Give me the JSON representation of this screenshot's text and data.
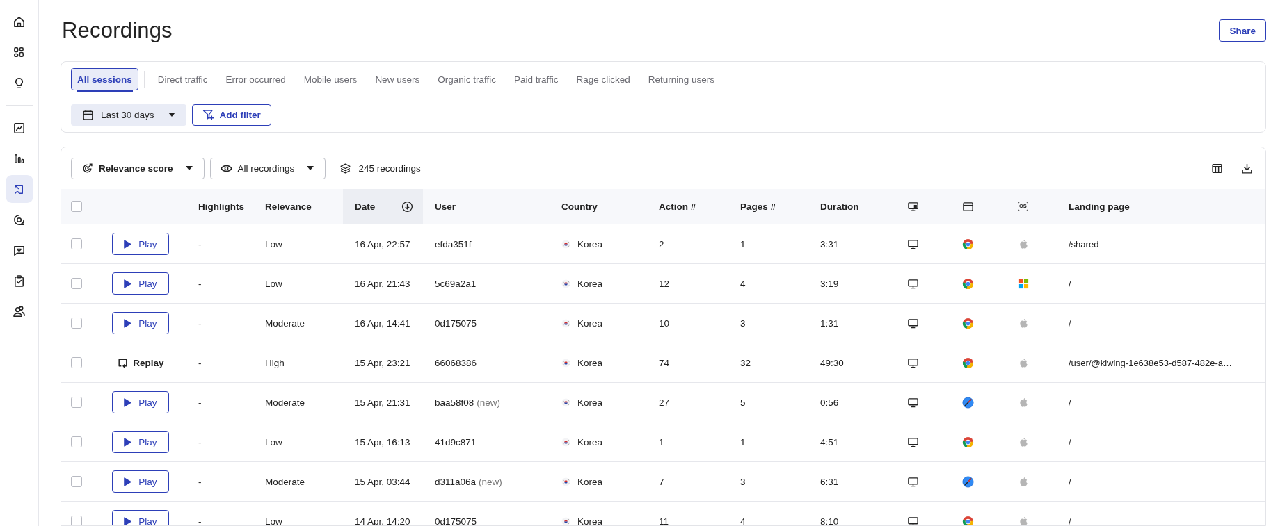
{
  "sidebar": {
    "top": [
      {
        "kind": "home",
        "selected": false
      },
      {
        "kind": "grid",
        "selected": false
      },
      {
        "kind": "bulb",
        "selected": false
      }
    ],
    "bottom": [
      {
        "kind": "chart",
        "selected": false
      },
      {
        "kind": "bars",
        "selected": false
      },
      {
        "kind": "recordings",
        "selected": true
      },
      {
        "kind": "mention",
        "selected": false
      },
      {
        "kind": "feedback",
        "selected": false
      },
      {
        "kind": "clipboard",
        "selected": false
      },
      {
        "kind": "users",
        "selected": false
      }
    ]
  },
  "title": "Recordings",
  "share_button": "Share",
  "segments": [
    {
      "label": "All sessions",
      "selected": true
    },
    {
      "label": "Direct traffic",
      "selected": false
    },
    {
      "label": "Error occurred",
      "selected": false
    },
    {
      "label": "Mobile users",
      "selected": false
    },
    {
      "label": "New users",
      "selected": false
    },
    {
      "label": "Organic traffic",
      "selected": false
    },
    {
      "label": "Paid traffic",
      "selected": false
    },
    {
      "label": "Rage clicked",
      "selected": false
    },
    {
      "label": "Returning users",
      "selected": false
    }
  ],
  "date_range": "Last 30 days",
  "add_filter": "Add filter",
  "sort_select": "Relevance score",
  "recordings_select": "All recordings",
  "recordings_count": "245 recordings",
  "table": {
    "select_all": {
      "checked": false
    },
    "columns": [
      {
        "kind": "text",
        "label": "Highlights"
      },
      {
        "kind": "text",
        "label": "Relevance"
      },
      {
        "kind": "sort",
        "label": "Date"
      },
      {
        "kind": "text",
        "label": "User"
      },
      {
        "kind": "text",
        "label": "Country"
      },
      {
        "kind": "text",
        "label": "Action #"
      },
      {
        "kind": "text",
        "label": "Pages #"
      },
      {
        "kind": "text",
        "label": "Duration"
      },
      {
        "kind": "device"
      },
      {
        "kind": "browser"
      },
      {
        "kind": "os",
        "label": "OS"
      },
      {
        "kind": "text",
        "label": "Landing page"
      }
    ],
    "rows": [
      {
        "checked": false,
        "kind": "play",
        "button": "Play",
        "highlights": "-",
        "relevance": "Low",
        "date": "16 Apr, 22:57",
        "user": "efda351f",
        "country": "Korea",
        "actions": "2",
        "pages": "1",
        "duration": "3:31",
        "browser": {
          "kind": "chrome"
        },
        "os": {
          "kind": "apple"
        },
        "landing": "/shared"
      },
      {
        "checked": false,
        "kind": "play",
        "button": "Play",
        "highlights": "-",
        "relevance": "Low",
        "date": "16 Apr, 21:43",
        "user": "5c69a2a1",
        "country": "Korea",
        "actions": "12",
        "pages": "4",
        "duration": "3:19",
        "browser": {
          "kind": "chrome"
        },
        "os": {
          "kind": "windows"
        },
        "landing": "/"
      },
      {
        "checked": false,
        "kind": "play",
        "button": "Play",
        "highlights": "-",
        "relevance": "Moderate",
        "date": "16 Apr, 14:41",
        "user": "0d175075",
        "country": "Korea",
        "actions": "10",
        "pages": "3",
        "duration": "1:31",
        "browser": {
          "kind": "chrome"
        },
        "os": {
          "kind": "apple"
        },
        "landing": "/"
      },
      {
        "checked": false,
        "kind": "replay",
        "button": "Replay",
        "highlights": "-",
        "relevance": "High",
        "date": "15 Apr, 23:21",
        "user": "66068386",
        "country": "Korea",
        "actions": "74",
        "pages": "32",
        "duration": "49:30",
        "browser": {
          "kind": "chrome"
        },
        "os": {
          "kind": "apple"
        },
        "landing": "/user/@kiwing-1e638e53-d587-482e-a…"
      },
      {
        "checked": false,
        "kind": "play",
        "button": "Play",
        "highlights": "-",
        "relevance": "Moderate",
        "date": "15 Apr, 21:31",
        "user": "baa58f08",
        "user_tag": "(new)",
        "country": "Korea",
        "actions": "27",
        "pages": "5",
        "duration": "0:56",
        "browser": {
          "kind": "safari"
        },
        "os": {
          "kind": "apple"
        },
        "landing": "/"
      },
      {
        "checked": false,
        "kind": "play",
        "button": "Play",
        "highlights": "-",
        "relevance": "Low",
        "date": "15 Apr, 16:13",
        "user": "41d9c871",
        "country": "Korea",
        "actions": "1",
        "pages": "1",
        "duration": "4:51",
        "browser": {
          "kind": "chrome"
        },
        "os": {
          "kind": "apple"
        },
        "landing": "/"
      },
      {
        "checked": false,
        "kind": "play",
        "button": "Play",
        "highlights": "-",
        "relevance": "Moderate",
        "date": "15 Apr, 03:44",
        "user": "d311a06a",
        "user_tag": "(new)",
        "country": "Korea",
        "actions": "7",
        "pages": "3",
        "duration": "6:31",
        "browser": {
          "kind": "safari"
        },
        "os": {
          "kind": "apple"
        },
        "landing": "/"
      },
      {
        "checked": false,
        "kind": "play",
        "button": "Play",
        "highlights": "-",
        "relevance": "Low",
        "date": "14 Apr, 14:20",
        "user": "0d175075",
        "country": "Korea",
        "actions": "11",
        "pages": "4",
        "duration": "8:10",
        "browser": {
          "kind": "chrome"
        },
        "os": {
          "kind": "apple"
        },
        "landing": "/"
      }
    ]
  }
}
